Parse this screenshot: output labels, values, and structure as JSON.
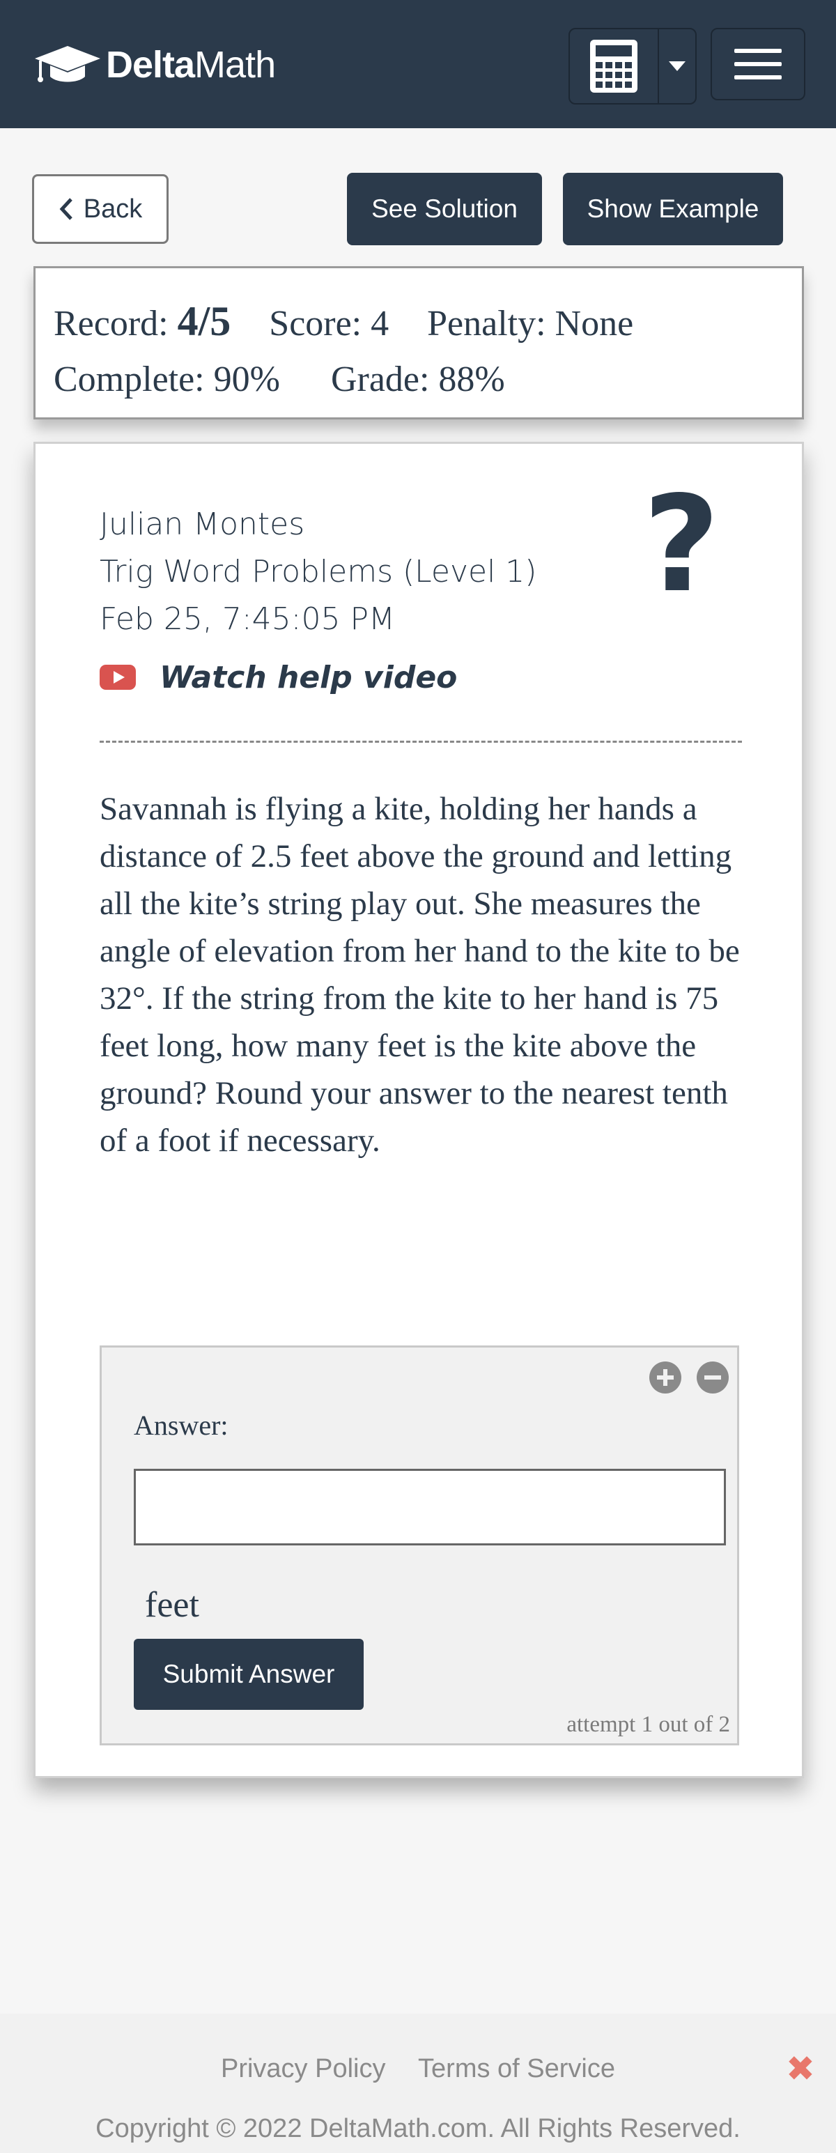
{
  "header": {
    "brand_bold": "Delta",
    "brand_rest": "Math",
    "icons": {
      "logo": "graduation-cap-icon",
      "calculator": "calculator-icon",
      "dropdown": "caret-down-icon",
      "menu": "hamburger-menu-icon"
    }
  },
  "actions": {
    "back_label": "Back",
    "see_solution_label": "See Solution",
    "show_example_label": "Show Example"
  },
  "record": {
    "record_label": "Record:",
    "record_value": "4/5",
    "score": "Score: 4",
    "penalty": "Penalty: None",
    "complete": "Complete: 90%",
    "grade": "Grade: 88%"
  },
  "problem": {
    "student": "Julian Montes",
    "skill": "Trig Word Problems (Level 1)",
    "timestamp": "Feb 25, 7:45:05 PM",
    "help_mark": "?",
    "help_video_label": "Watch help video",
    "text": "Savannah is flying a kite, holding her hands a distance of 2.5 feet above the ground and letting all the kite’s string play out. She measures the angle of elevation from her hand to the kite to be 32°. If the string from the kite to her hand is 75 feet long, how many feet is the kite above the ground? Round your answer to the nearest tenth of a foot if necessary."
  },
  "answer": {
    "label": "Answer:",
    "value": "",
    "placeholder": "",
    "units": "feet",
    "submit_label": "Submit Answer",
    "attempt_text": "attempt 1 out of 2"
  },
  "footer": {
    "privacy": "Privacy Policy",
    "terms": "Terms of Service",
    "copyright": "Copyright © 2022 DeltaMath.com. All Rights Reserved.",
    "close_symbol": "✖"
  },
  "colors": {
    "navbar": "#2b3a4b",
    "button_dark": "#2b3a4b",
    "youtube_red": "#d9534f",
    "close_red": "#e8776b"
  }
}
